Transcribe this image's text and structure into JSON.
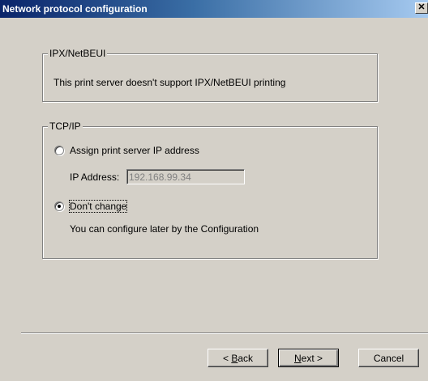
{
  "window": {
    "title": "Network protocol configuration",
    "close_glyph": "✕"
  },
  "ipx_group": {
    "legend": "IPX/NetBEUI",
    "message": "This print server doesn't support IPX/NetBEUI printing"
  },
  "tcpip_group": {
    "legend": "TCP/IP",
    "assign_option": {
      "label": "Assign print server IP address",
      "selected": false
    },
    "ip_address": {
      "label": "IP Address:",
      "value": "192.168.99.34",
      "enabled": false
    },
    "dont_change_option": {
      "label": "Don't change",
      "selected": true
    },
    "hint": "You can configure later by the Configuration"
  },
  "buttons": {
    "back": {
      "prefix": "< ",
      "mnemonic": "B",
      "rest": "ack"
    },
    "next": {
      "mnemonic": "N",
      "rest": "ext >"
    },
    "cancel": {
      "label": "Cancel"
    }
  }
}
